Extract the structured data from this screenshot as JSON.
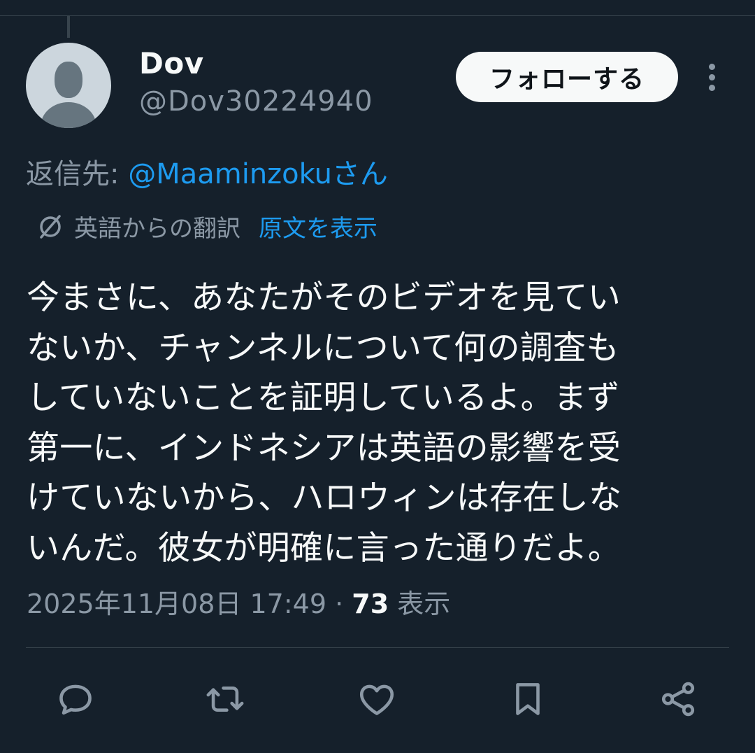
{
  "user": {
    "display_name": "Dov",
    "handle": "@Dov30224940"
  },
  "follow_button": {
    "label": "フォローする"
  },
  "reply_to": {
    "prefix": "返信先: ",
    "mention": "@Maaminzokuさん"
  },
  "translation": {
    "label": "英語からの翻訳",
    "show_original": "原文を表示"
  },
  "tweet": {
    "lines": [
      "今まさに、あなたがそのビデオを見てい",
      "ないか、チャンネルについて何の調査も",
      "していないことを証明しているよ。まず",
      "第一に、インドネシアは英語の影響を受",
      "けていないから、ハロウィンは存在しな",
      "いんだ。彼女が明確に言った通りだよ。"
    ]
  },
  "meta": {
    "timestamp": "2025年11月08日 17:49",
    "separator": " · ",
    "view_count": "73",
    "view_label": " 表示"
  },
  "actions": {
    "reply_icon": "reply-icon",
    "retweet_icon": "retweet-icon",
    "like_icon": "heart-icon",
    "bookmark_icon": "bookmark-icon",
    "share_icon": "share-icon"
  },
  "colors": {
    "background": "#15202b",
    "text_primary": "#f7f9f9",
    "text_secondary": "#8b98a5",
    "accent": "#1d9bf0",
    "divider": "#38444d"
  }
}
